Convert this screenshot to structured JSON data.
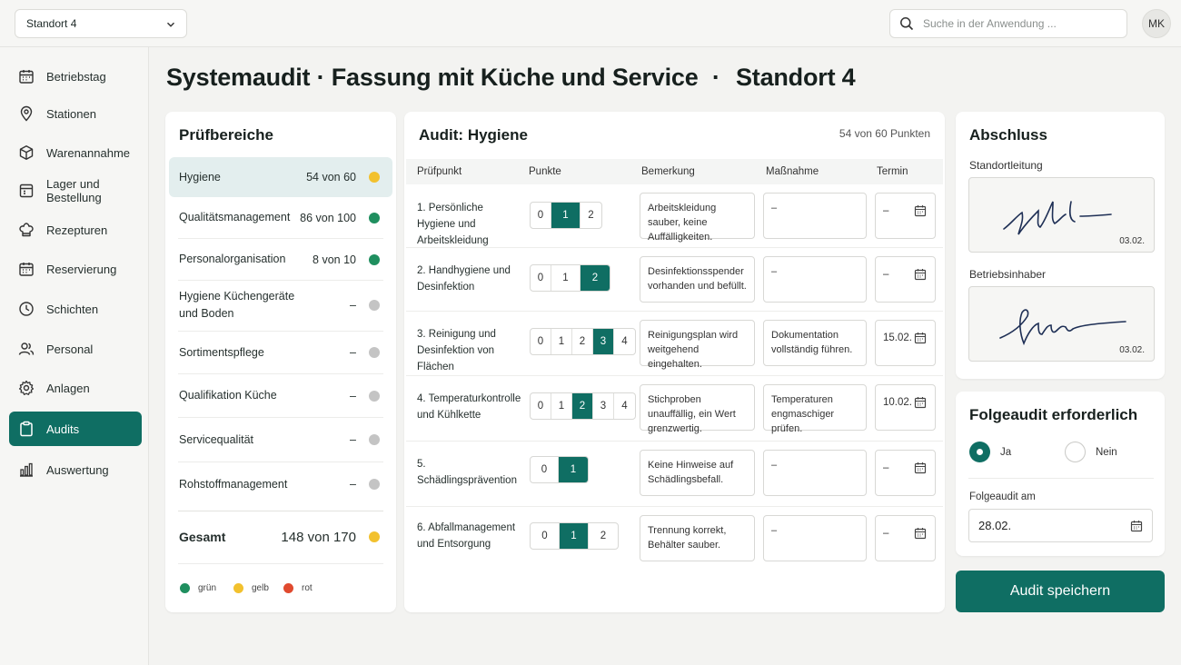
{
  "header": {
    "location": "Standort 4",
    "search_placeholder": "Suche in der Anwendung ...",
    "user_initials": "MK"
  },
  "sidebar": {
    "items": [
      {
        "label": "Betriebstag",
        "icon": "calendar-icon"
      },
      {
        "label": "Stationen",
        "icon": "location-pin-icon"
      },
      {
        "label": "Warenannahme",
        "icon": "box-icon"
      },
      {
        "label": "Lager und Bestellung",
        "icon": "clipboard-icon"
      },
      {
        "label": "Rezepturen",
        "icon": "chef-hat-icon"
      },
      {
        "label": "Reservierung",
        "icon": "calendar-icon"
      },
      {
        "label": "Schichten",
        "icon": "clock-icon"
      },
      {
        "label": "Personal",
        "icon": "people-icon"
      },
      {
        "label": "Anlagen",
        "icon": "gear-icon"
      },
      {
        "label": "Audits",
        "icon": "clipboard-check-icon",
        "active": true
      },
      {
        "label": "Auswertung",
        "icon": "bar-chart-icon"
      }
    ]
  },
  "page": {
    "title_part1": "Systemaudit · Fassung mit Küche und Service",
    "title_sep": "·",
    "title_part2": "Standort 4"
  },
  "categories": {
    "title": "Prüfbereiche",
    "items": [
      {
        "name": "Hygiene",
        "score": "54 von 60",
        "status": "gelb",
        "color": "#f2c12e",
        "active": true
      },
      {
        "name": "Qualitätsmanagement",
        "score": "86 von 100",
        "status": "grün",
        "color": "#1f8f5f"
      },
      {
        "name": "Personalorganisation",
        "score": "8 von 10",
        "status": "grün",
        "color": "#1f8f5f"
      },
      {
        "name": "Hygiene Küchengeräte und Boden",
        "score": "–",
        "status": "none",
        "color": "#c4c4c4"
      },
      {
        "name": "Sortimentspflege",
        "score": "–",
        "status": "none",
        "color": "#c4c4c4"
      },
      {
        "name": "Qualifikation Küche",
        "score": "–",
        "status": "none",
        "color": "#c4c4c4"
      },
      {
        "name": "Servicequalität",
        "score": "–",
        "status": "none",
        "color": "#c4c4c4"
      },
      {
        "name": "Rohstoffmanagement",
        "score": "–",
        "status": "none",
        "color": "#c4c4c4"
      }
    ],
    "total_label": "Gesamt",
    "total_score": "148 von 170",
    "total_color": "#f2c12e",
    "legend": [
      {
        "label": "grün",
        "color": "#1f8f5f"
      },
      {
        "label": "gelb",
        "color": "#f2c12e"
      },
      {
        "label": "rot",
        "color": "#e04a2f"
      }
    ]
  },
  "audit": {
    "title": "Audit: Hygiene",
    "score": "54 von 60 Punkten",
    "columns": [
      "Prüfpunkt",
      "Punkte",
      "Bemerkung",
      "Maßnahme",
      "Termin"
    ],
    "rows": [
      {
        "label": "1. Persönliche Hygiene und Arbeitskleidung",
        "options": [
          "0",
          "1",
          "2"
        ],
        "selected": "1",
        "remark": "Arbeitskleidung sauber, keine Auffälligkeiten.",
        "measure": "–",
        "date": "–"
      },
      {
        "label": "2. Handhygiene und Desinfektion",
        "options": [
          "0",
          "1",
          "2"
        ],
        "selected": "2",
        "remark": "Desinfektionsspender vorhanden und befüllt.",
        "measure": "–",
        "date": "–"
      },
      {
        "label": "3. Reinigung und Desinfektion von Flächen",
        "options": [
          "0",
          "1",
          "2",
          "3",
          "4"
        ],
        "selected": "3",
        "remark": "Reinigungsplan wird weitgehend eingehalten.",
        "measure": "Dokumentation vollständig führen.",
        "date": "15.02."
      },
      {
        "label": "4. Temperaturkontrolle und Kühlkette",
        "options": [
          "0",
          "1",
          "2",
          "3",
          "4"
        ],
        "selected": "2",
        "remark": "Stichproben unauffällig, ein Wert grenzwertig.",
        "measure": "Temperaturen engmaschiger prüfen.",
        "date": "10.02."
      },
      {
        "label": "5. Schädlingsprävention",
        "options": [
          "0",
          "1"
        ],
        "selected": "1",
        "remark": "Keine Hinweise auf Schädlingsbefall.",
        "measure": "–",
        "date": "–"
      },
      {
        "label": "6. Abfallmanagement und Entsorgung",
        "options": [
          "0",
          "1",
          "2"
        ],
        "selected": "1",
        "remark": "Trennung korrekt, Behälter sauber.",
        "measure": "–",
        "date": "–"
      }
    ]
  },
  "closing": {
    "title": "Abschluss",
    "sig1_label": "Standortleitung",
    "sig1_date": "03.02.",
    "sig2_label": "Betriebsinhaber",
    "sig2_date": "03.02."
  },
  "followup": {
    "title": "Folgeaudit erforderlich",
    "yes": "Ja",
    "no": "Nein",
    "selected": "Ja",
    "date_label": "Folgeaudit am",
    "date": "28.02."
  },
  "save_label": "Audit speichern",
  "accent": "#0f6e63"
}
